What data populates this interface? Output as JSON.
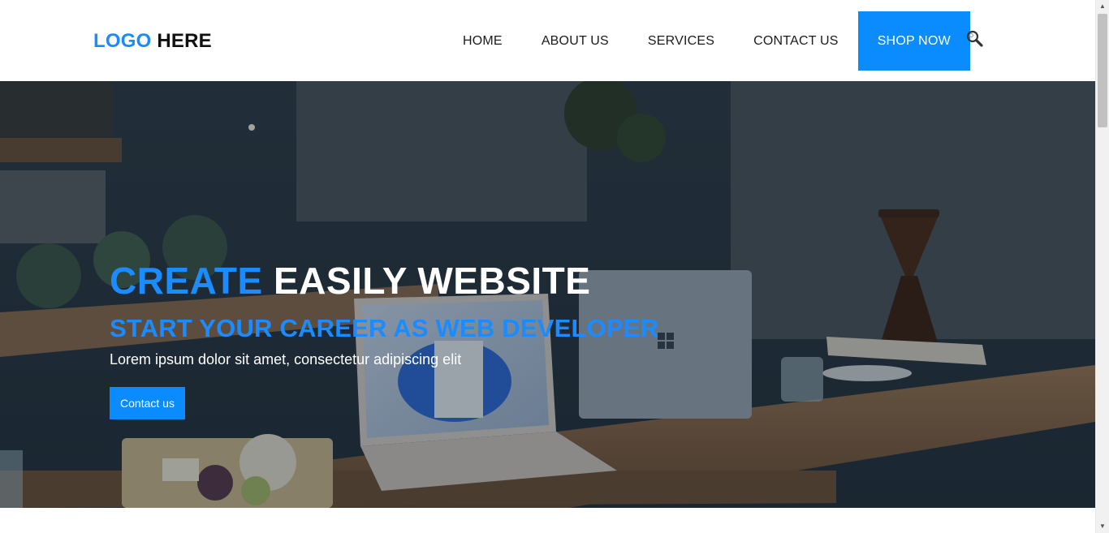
{
  "header": {
    "logo_part1": "LOGO",
    "logo_part2": "HERE",
    "nav": [
      {
        "label": "HOME"
      },
      {
        "label": "ABOUT US"
      },
      {
        "label": "SERVICES"
      },
      {
        "label": "CONTACT US"
      }
    ],
    "cta_label": "SHOP NOW",
    "search_icon": "search-icon"
  },
  "hero": {
    "title_accent": "CREATE",
    "title_rest": "EASILY WEBSITE",
    "subtitle": "START YOUR CAREER AS WEB DEVELOPER",
    "text": "Lorem ipsum dolor sit amet, consectetur adipiscing elit",
    "button_label": "Contact us"
  },
  "colors": {
    "accent": "#0a8cff",
    "dark_text": "#111111",
    "white": "#ffffff"
  }
}
